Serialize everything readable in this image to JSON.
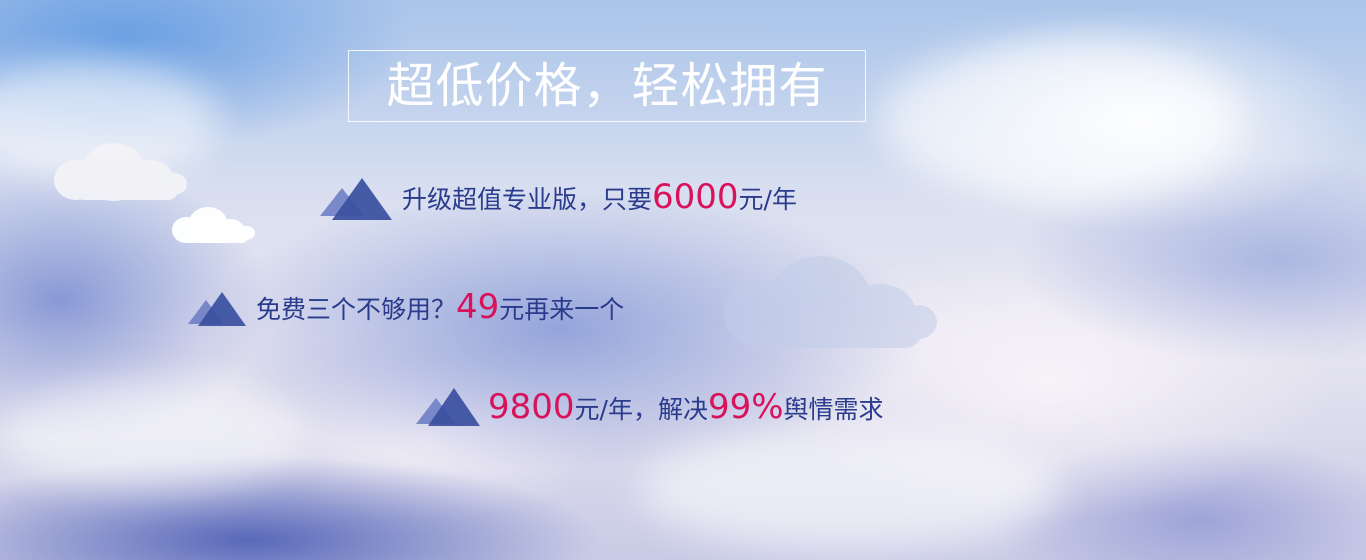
{
  "banner": {
    "title": "超低价格，轻松拥有",
    "lines": [
      {
        "pre": "升级超值专业版，只要",
        "highlight": "6000",
        "post": "元/年"
      },
      {
        "pre": "免费三个不够用？",
        "highlight": "49",
        "post": "元再来一个"
      },
      {
        "highlight1": "9800",
        "mid": "元/年，解决",
        "highlight2": "99%",
        "post": "舆情需求"
      }
    ]
  },
  "colors": {
    "text": "#2a3b8c",
    "highlight": "#d8125b",
    "triangle_dark": "#3a4fa0",
    "triangle_light": "#6f80c4",
    "title": "#ffffff"
  },
  "icons": [
    "cloud-icon",
    "triangle-icon"
  ]
}
